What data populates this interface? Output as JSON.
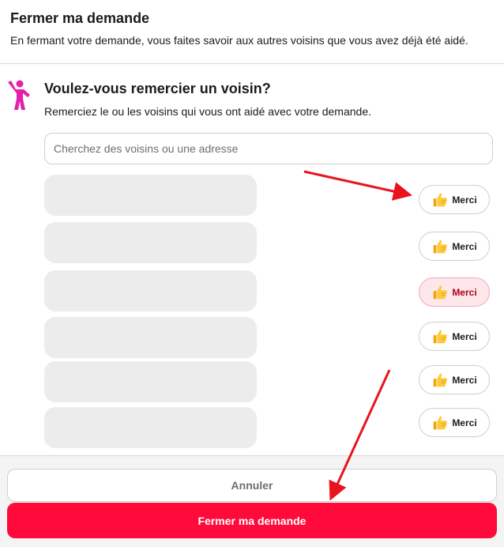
{
  "header": {
    "title": "Fermer ma demande",
    "subtitle": "En fermant votre demande, vous faites savoir aux autres voisins que vous avez déjà été aidé."
  },
  "thank_section": {
    "icon": "person-raising-hand-icon",
    "title": "Voulez-vous remercier un voisin?",
    "subtitle": "Remerciez le ou les voisins qui vous ont aidé avec votre demande."
  },
  "search": {
    "placeholder": "Cherchez des voisins ou une adresse",
    "value": ""
  },
  "neighbors": [
    {
      "merci_label": "Merci",
      "selected": false
    },
    {
      "merci_label": "Merci",
      "selected": false
    },
    {
      "merci_label": "Merci",
      "selected": true
    },
    {
      "merci_label": "Merci",
      "selected": false
    },
    {
      "merci_label": "Merci",
      "selected": false
    },
    {
      "merci_label": "Merci",
      "selected": false
    }
  ],
  "footer": {
    "cancel_label": "Annuler",
    "close_label": "Fermer ma demande"
  },
  "colors": {
    "brand": "#ff0a3a",
    "icon_magenta": "#e620a8",
    "annotation_arrow": "#e8141e"
  }
}
